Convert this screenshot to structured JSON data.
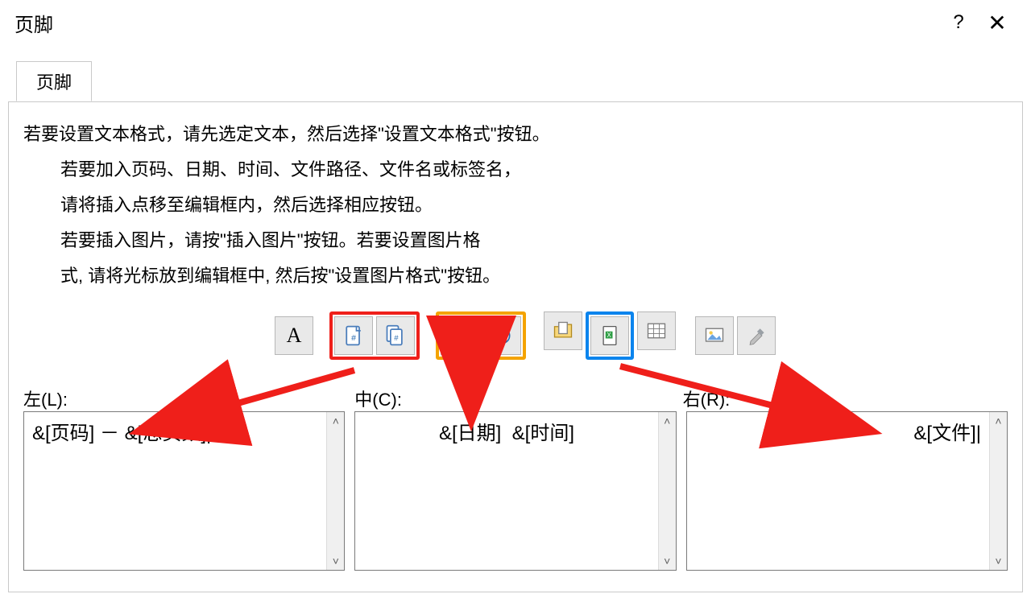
{
  "window": {
    "title": "页脚",
    "help_symbol": "?",
    "close_symbol": "✕"
  },
  "tab": {
    "label": "页脚"
  },
  "instructions": {
    "l1": "若要设置文本格式，请先选定文本，然后选择\"设置文本格式\"按钮。",
    "l2": "若要加入页码、日期、时间、文件路径、文件名或标签名，",
    "l3": "请将插入点移至编辑框内，然后选择相应按钮。",
    "l4": "若要插入图片，请按\"插入图片\"按钮。若要设置图片格",
    "l5": "式, 请将光标放到编辑框中, 然后按\"设置图片格式\"按钮。"
  },
  "toolbar": {
    "format_text": "A",
    "icons": {
      "page_number": "page-number-icon",
      "page_count": "page-count-icon",
      "date": "date-icon",
      "time": "time-icon",
      "file_path": "file-path-icon",
      "file_name": "file-name-icon",
      "sheet_name": "sheet-name-icon",
      "insert_pic": "insert-picture-icon",
      "format_pic": "format-picture-icon"
    }
  },
  "sections": {
    "left_label": "左(L):",
    "center_label": "中(C):",
    "right_label": "右(R):",
    "left_value": "&[页码] － &[总页数]|",
    "center_value": "&[日期]  &[时间]",
    "right_value": "&[文件]|"
  },
  "highlight_colors": {
    "red": "#ef1f1a",
    "orange": "#f4a300",
    "blue": "#0b84ed"
  }
}
